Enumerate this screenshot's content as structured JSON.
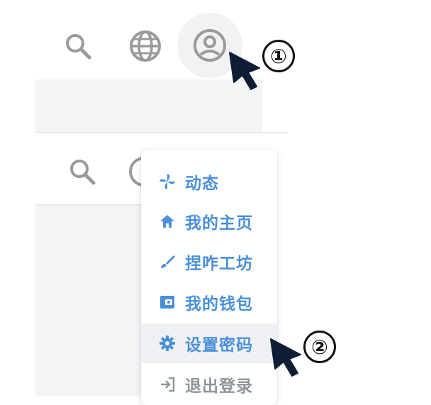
{
  "header": {
    "icons": [
      "search-icon",
      "globe-icon",
      "user-avatar-icon"
    ]
  },
  "dropdown": {
    "items": [
      {
        "label": "动态",
        "icon": "pinwheel-icon"
      },
      {
        "label": "我的主页",
        "icon": "home-icon"
      },
      {
        "label": "捏咋工坊",
        "icon": "brush-icon"
      },
      {
        "label": "我的钱包",
        "icon": "wallet-icon"
      },
      {
        "label": "设置密码",
        "icon": "gear-icon"
      },
      {
        "label": "退出登录",
        "icon": "logout-icon"
      }
    ]
  },
  "annotations": {
    "step1": "①",
    "step2": "②"
  },
  "colors": {
    "accent": "#4a90d9",
    "muted": "#8e959c",
    "icon_gray": "#9a9a9a"
  }
}
